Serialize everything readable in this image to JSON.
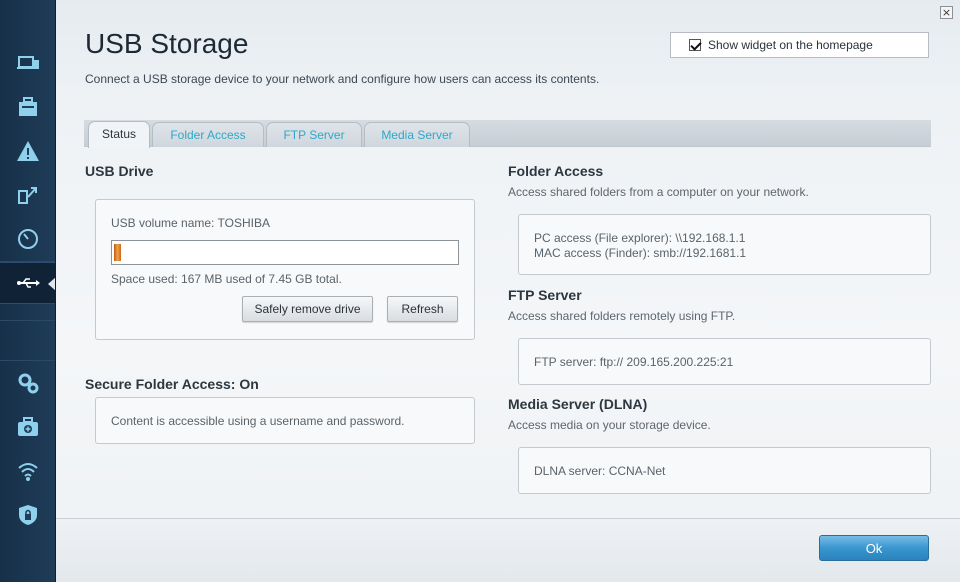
{
  "window": {
    "close_glyph": "×"
  },
  "header": {
    "title": "USB Storage",
    "description": "Connect a USB storage device to your network and configure how users can access its contents.",
    "widget_checkbox_label": "Show widget on the homepage",
    "widget_checked": true
  },
  "sidebar": {
    "items": [
      {
        "icon": "devices-icon"
      },
      {
        "icon": "toolbox-icon"
      },
      {
        "icon": "alert-icon"
      },
      {
        "icon": "priority-icon"
      },
      {
        "icon": "speedometer-icon"
      },
      {
        "icon": "usb-icon",
        "active": true
      },
      {
        "icon": "gears-icon"
      },
      {
        "icon": "troubleshoot-icon"
      },
      {
        "icon": "wifi-icon"
      },
      {
        "icon": "security-icon"
      }
    ]
  },
  "tabs": [
    {
      "label": "Status",
      "active": true
    },
    {
      "label": "Folder Access"
    },
    {
      "label": "FTP Server"
    },
    {
      "label": "Media Server"
    }
  ],
  "usb_drive": {
    "title": "USB Drive",
    "volume_label": "USB volume name: TOSHIBA",
    "usage_fraction": 0.02,
    "space_used": "Space used: 167 MB used of 7.45 GB total.",
    "remove_button": "Safely remove drive",
    "refresh_button": "Refresh"
  },
  "secure_folder": {
    "title": "Secure Folder Access: On",
    "text": "Content is accessible using a username and password."
  },
  "folder_access": {
    "title": "Folder Access",
    "subtitle": "Access shared folders from a computer on your network.",
    "pc_access": "PC access (File explorer): \\\\192.168.1.1",
    "mac_access": "MAC access (Finder): smb://192.1681.1"
  },
  "ftp_server": {
    "title": "FTP Server",
    "subtitle": "Access shared folders remotely using FTP.",
    "value": "FTP server: ftp:// 209.165.200.225:21"
  },
  "media_server": {
    "title": "Media Server (DLNA)",
    "subtitle": "Access media on your storage device.",
    "value": "DLNA server: CCNA-Net"
  },
  "footer": {
    "ok_label": "Ok"
  },
  "colors": {
    "accent": "#2fa8c9",
    "ok_button": "#3996cf",
    "sidebar": "#1b3246"
  }
}
